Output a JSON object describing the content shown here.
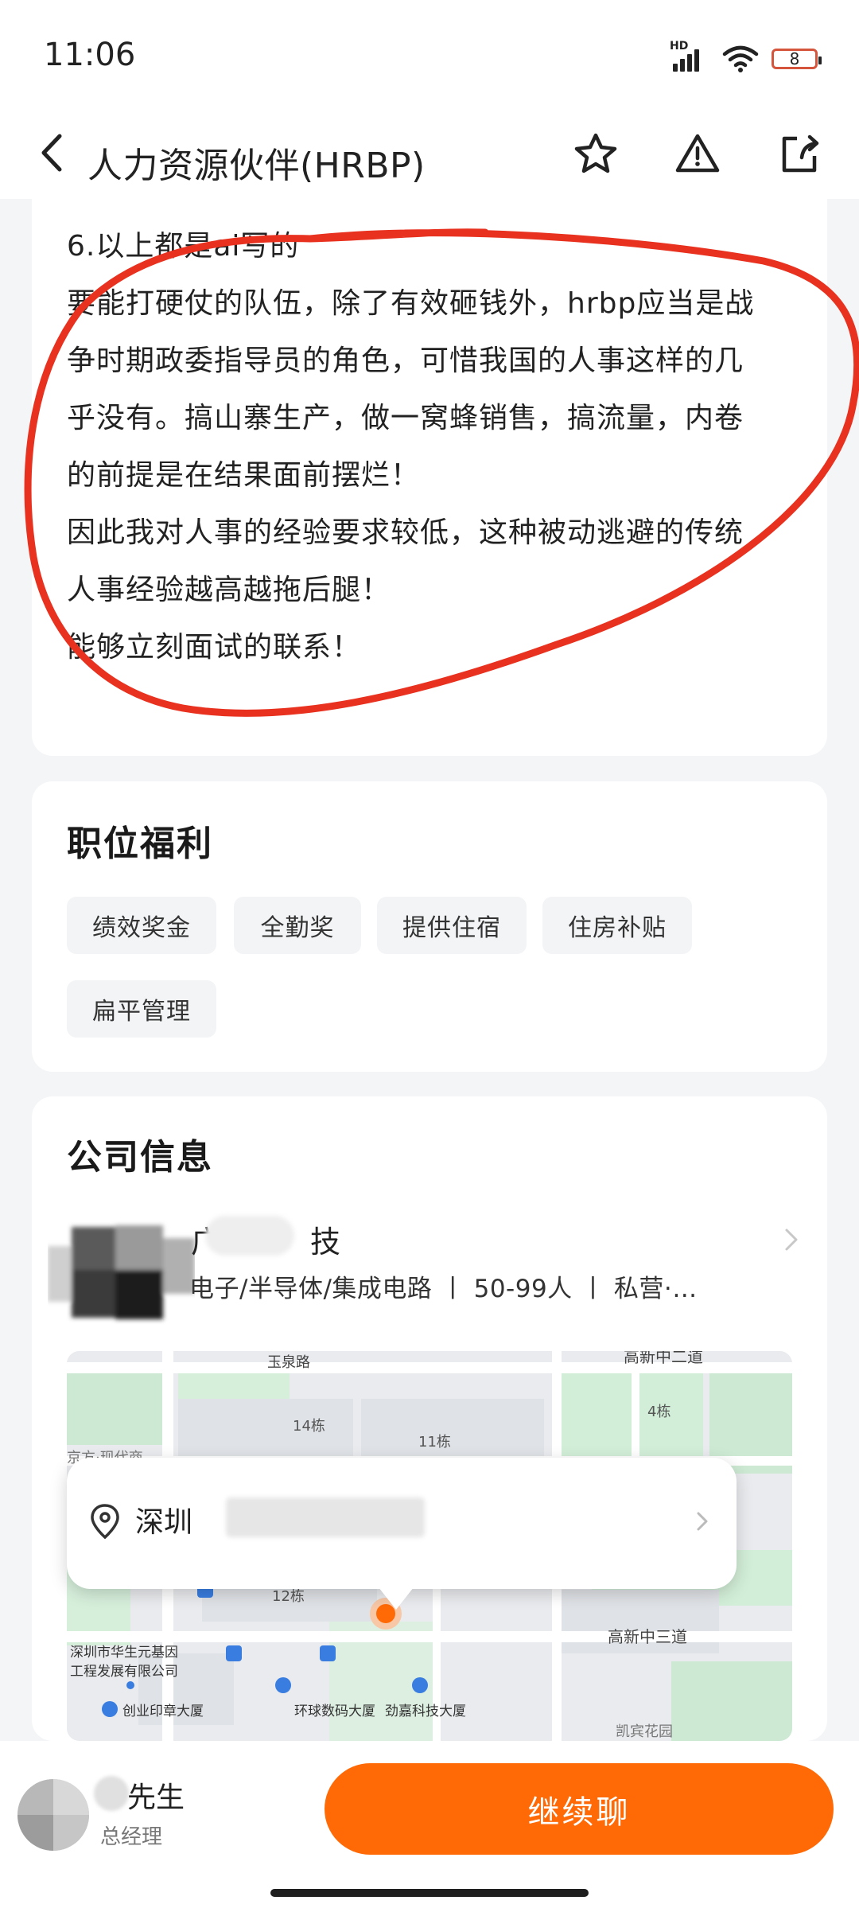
{
  "status_bar": {
    "time": "11:06",
    "network_label": "HD",
    "battery_level": "8"
  },
  "nav": {
    "title": "人力资源伙伴(HRBP)",
    "icons": [
      "back-arrow-icon",
      "star-icon",
      "warning-icon",
      "share-icon"
    ]
  },
  "description": {
    "lines": [
      "6.以上都是ai写的",
      "要能打硬仗的队伍，除了有效砸钱外，hrbp应当是战",
      "争时期政委指导员的角色，可惜我国的人事这样的几",
      "乎没有。搞山寨生产，做一窝蜂销售，搞流量，内卷",
      "的前提是在结果面前摆烂！",
      "因此我对人事的经验要求较低，这种被动逃避的传统",
      "人事经验越高越拖后腿！",
      "能够立刻面试的联系！"
    ],
    "annotation_color": "#e8311f"
  },
  "benefits": {
    "title": "职位福利",
    "tags": [
      "绩效奖金",
      "全勤奖",
      "提供住宿",
      "住房补贴",
      "扁平管理"
    ]
  },
  "company": {
    "title": "公司信息",
    "name_prefix": "广",
    "name_suffix": "技",
    "meta": "电子/半导体/集成电路 丨 50-99人 丨 私营·…",
    "map": {
      "labels": [
        "玉泉路",
        "高新中二道",
        "14栋",
        "11栋",
        "4栋",
        "12栋",
        "高新中三道",
        "深圳市华生元基因",
        "工程发展有限公司",
        "创业印章大厦",
        "环球数码大厦",
        "劲嘉科技大厦",
        "京方·现代商",
        "凯宾花园"
      ]
    },
    "address": "深圳"
  },
  "recruiter": {
    "name": "先生",
    "title": "总经理"
  },
  "actions": {
    "chat_label": "继续聊",
    "accent_color": "#ff6a06"
  }
}
